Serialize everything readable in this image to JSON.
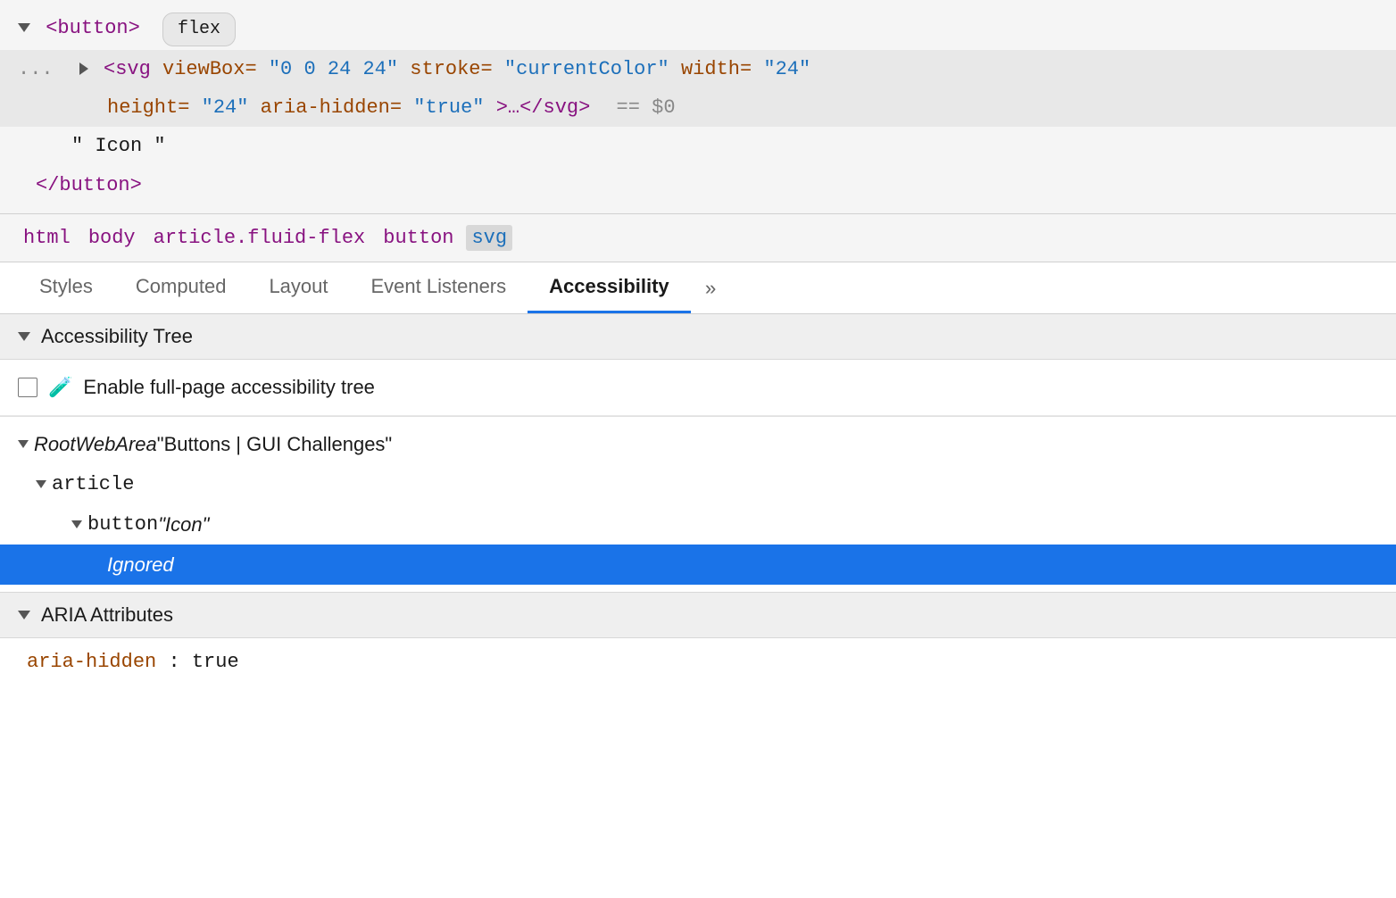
{
  "dom_inspector": {
    "line1": {
      "indent": "",
      "triangle": "down",
      "content_purple": "<button>",
      "badge_text": "flex"
    },
    "line2": {
      "ellipsis": "...",
      "triangle": "right",
      "svg_tag_start_purple": "<svg",
      "attr1_orange": " viewBox=",
      "attr1_val_blue": "\"0 0 24 24\"",
      "attr2_orange": " stroke=",
      "attr2_val_blue": "\"currentColor\"",
      "attr3_orange": " width=",
      "attr3_val_blue": "\"24\""
    },
    "line3": {
      "attr4_orange": "height=",
      "attr4_val_blue": "\"24\"",
      "attr5_orange": " aria-hidden=",
      "attr5_val_blue": "\"true\"",
      "close": ">…</svg>",
      "dollar": "== $0"
    },
    "line4": {
      "text": "\" Icon \""
    },
    "line5": {
      "close_purple": "</button>"
    }
  },
  "breadcrumb": {
    "items": [
      "html",
      "body",
      "article.fluid-flex",
      "button",
      "svg"
    ]
  },
  "tabs": {
    "items": [
      "Styles",
      "Computed",
      "Layout",
      "Event Listeners",
      "Accessibility"
    ],
    "active_index": 4,
    "more_label": "»"
  },
  "accessibility_tree_section": {
    "header": "Accessibility Tree",
    "enable_row": {
      "label": "Enable full-page accessibility tree"
    },
    "tree_items": [
      {
        "level": 0,
        "chevron": true,
        "text_italic": "RootWebArea",
        "text_normal": " \"Buttons | GUI Challenges\""
      },
      {
        "level": 1,
        "chevron": true,
        "text_mono": "article",
        "text_normal": ""
      },
      {
        "level": 2,
        "chevron": true,
        "text_mono": "button",
        "text_italic": " \"Icon\""
      },
      {
        "level": 3,
        "chevron": false,
        "text_italic": "Ignored",
        "selected": true
      }
    ]
  },
  "aria_section": {
    "header": "ARIA Attributes",
    "attributes": [
      {
        "key": "aria-hidden",
        "value": ": true"
      }
    ]
  }
}
